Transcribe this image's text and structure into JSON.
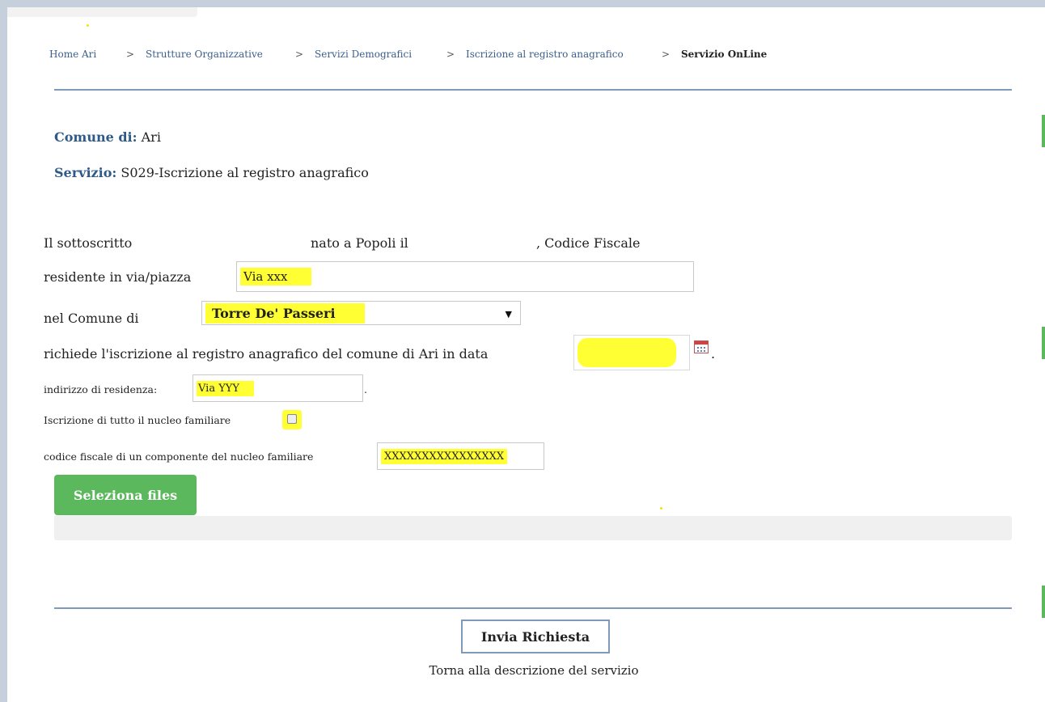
{
  "breadcrumb": {
    "items": [
      "Home Ari",
      "Strutture Organizzative",
      "Servizi Demografici",
      "Iscrizione al registro anagrafico",
      "Servizio OnLine"
    ],
    "separator": ">"
  },
  "header": {
    "comune_label": "Comune di:",
    "comune_value": "Ari",
    "servizio_label": "Servizio:",
    "servizio_value": "S029-Iscrizione al registro anagrafico"
  },
  "form": {
    "intro_part1": "Il sottoscritto",
    "intro_part2": "nato a Popoli il",
    "intro_part3": ", Codice Fiscale",
    "residente_label": "residente in via/piazza",
    "residente_value": "Via xxx",
    "comune_label": "nel Comune di",
    "comune_selected": "Torre De' Passeri",
    "richiede_label": "richiede l'iscrizione al registro anagrafico del comune di Ari in data",
    "richiede_suffix": ".",
    "indirizzo_label": "indirizzo di residenza:",
    "indirizzo_value": "Via YYY",
    "indirizzo_suffix": ".",
    "nucleo_label": "Iscrizione di tutto il nucleo familiare",
    "codice_label": "codice fiscale di un componente del nucleo familiare",
    "codice_value": "XXXXXXXXXXXXXXXX"
  },
  "actions": {
    "select_files": "Seleziona files",
    "submit": "Invia Richiesta",
    "back_link": "Torna alla descrizione del servizio"
  },
  "colors": {
    "accent_blue": "#2e5a8a",
    "green_button": "#5cb85c",
    "highlight": "#ffff33"
  }
}
